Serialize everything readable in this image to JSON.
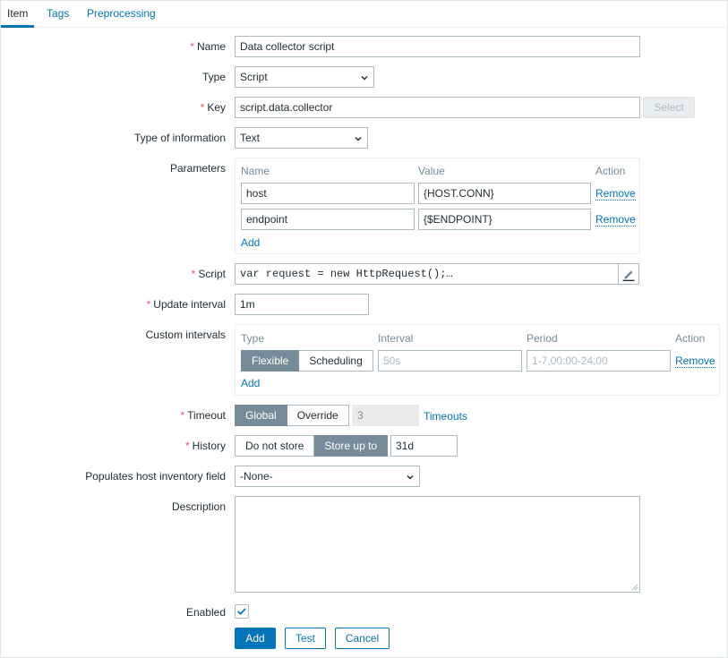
{
  "tabs": [
    {
      "label": "Item"
    },
    {
      "label": "Tags"
    },
    {
      "label": "Preprocessing"
    }
  ],
  "form": {
    "name": {
      "label": "Name",
      "value": "Data collector script"
    },
    "type": {
      "label": "Type",
      "value": "Script"
    },
    "key": {
      "label": "Key",
      "value": "script.data.collector",
      "select_label": "Select"
    },
    "type_of_information": {
      "label": "Type of information",
      "value": "Text"
    },
    "parameters": {
      "label": "Parameters",
      "headers": {
        "name": "Name",
        "value": "Value",
        "action": "Action"
      },
      "rows": [
        {
          "name": "host",
          "value": "{HOST.CONN}",
          "action": "Remove"
        },
        {
          "name": "endpoint",
          "value": "{$ENDPOINT}",
          "action": "Remove"
        }
      ],
      "add_label": "Add"
    },
    "script": {
      "label": "Script",
      "value": "var request = new HttpRequest();…"
    },
    "update_interval": {
      "label": "Update interval",
      "value": "1m"
    },
    "custom_intervals": {
      "label": "Custom intervals",
      "headers": {
        "type": "Type",
        "interval": "Interval",
        "period": "Period",
        "action": "Action"
      },
      "row": {
        "type_options": [
          "Flexible",
          "Scheduling"
        ],
        "selected": "Flexible",
        "interval_placeholder": "50s",
        "period_placeholder": "1-7,00:00-24:00",
        "action": "Remove"
      },
      "add_label": "Add"
    },
    "timeout": {
      "label": "Timeout",
      "options": [
        "Global",
        "Override"
      ],
      "selected": "Global",
      "value": "3",
      "link": "Timeouts"
    },
    "history": {
      "label": "History",
      "options": [
        "Do not store",
        "Store up to"
      ],
      "selected": "Store up to",
      "value": "31d"
    },
    "inventory": {
      "label": "Populates host inventory field",
      "value": "-None-"
    },
    "description": {
      "label": "Description",
      "value": ""
    },
    "enabled": {
      "label": "Enabled",
      "checked": true
    }
  },
  "buttons": {
    "add": "Add",
    "test": "Test",
    "cancel": "Cancel"
  },
  "colors": {
    "accent": "#0275b8",
    "required": "#e45959",
    "segment_on": "#768d99"
  }
}
